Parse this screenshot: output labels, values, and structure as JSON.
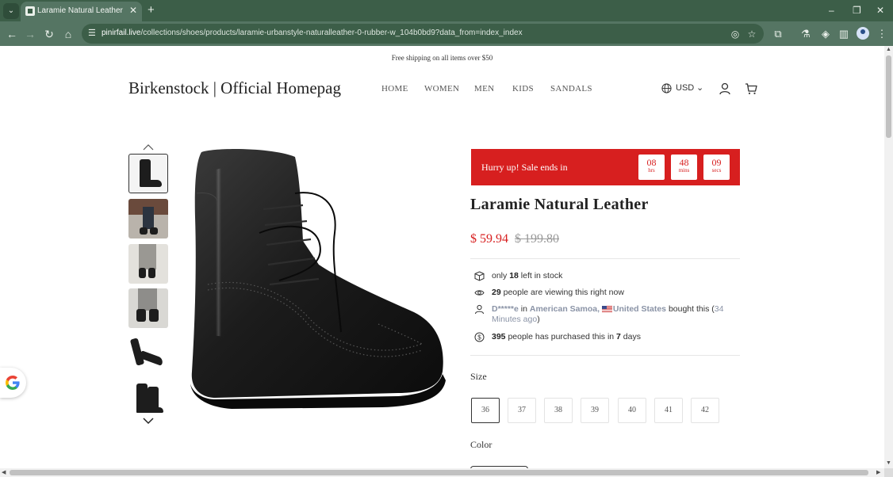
{
  "browser": {
    "tab_title": "Laramie Natural Leather",
    "url_host": "pinirfail.live",
    "url_path": "/collections/shoes/products/laramie-urbanstyle-naturalleather-0-rubber-w_104b0bd9?data_from=index_index",
    "icons": [
      "tab-list-icon",
      "favicon-icon",
      "close-icon",
      "new-tab-icon",
      "minimize-icon",
      "restore-icon",
      "window-close-icon",
      "back-icon",
      "forward-icon",
      "reload-icon",
      "home-icon",
      "site-info-icon",
      "eye-slash-icon",
      "bookmark-star-icon",
      "extensions-icon",
      "lab-icon",
      "feed-icon",
      "side-panel-icon",
      "profile-icon",
      "menu-kebab-icon"
    ]
  },
  "store": {
    "announcement": "Free shipping on all items over $50",
    "logo": "Birkenstock | Official Homepag",
    "nav": [
      "HOME",
      "WOMEN",
      "MEN",
      "KIDS",
      "SANDALS"
    ],
    "currency": "USD"
  },
  "gallery": {
    "thumbnail_count": 6,
    "active_index": 0
  },
  "sale": {
    "label": "Hurry up!  Sale ends in",
    "hours": "08",
    "hours_unit": "hrs",
    "mins": "48",
    "mins_unit": "mins",
    "secs": "09",
    "secs_unit": "secs"
  },
  "product": {
    "title": "Laramie Natural Leather",
    "price": "$ 59.94",
    "compare_price": "$ 199.80"
  },
  "info": {
    "stock_pre": "only ",
    "stock_count": "18",
    "stock_post": " left in stock",
    "viewers_count": "29",
    "viewers_text": " people are viewing this right now",
    "buyer_name": "D*****e",
    "buyer_in": " in ",
    "buyer_region": "American Samoa,",
    "buyer_country": "United States",
    "buyer_bought": " bought this (",
    "buyer_ago": "34 Minutes ago",
    "buyer_close": ")",
    "purchased_count": "395",
    "purchased_text": " people has purchased this in ",
    "purchased_days": "7",
    "purchased_days_unit": " days"
  },
  "size": {
    "label": "Size",
    "options": [
      "36",
      "37",
      "38",
      "39",
      "40",
      "41",
      "42"
    ],
    "selected": "36"
  },
  "color": {
    "label": "Color"
  },
  "colors": {
    "chrome_dark": "#3c5e48",
    "chrome_light": "#557563",
    "sale_red": "#d71f1f",
    "muted_text": "#8a93a6"
  }
}
